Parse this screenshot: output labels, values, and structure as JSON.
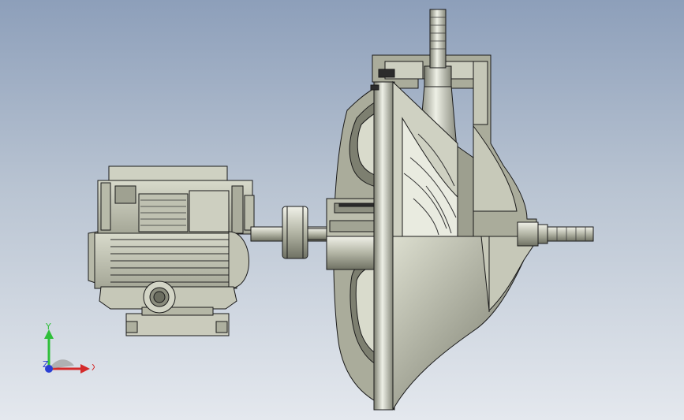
{
  "viewport": {
    "background_top": "#8d9fba",
    "background_bottom": "#e4e8ee"
  },
  "model": {
    "name": "pump-motor-section-view",
    "face_color": "#c9cbbb",
    "face_light": "#e6e8dc",
    "face_dark": "#8e907f",
    "edge_color": "#1a1a1a",
    "section_color": "#aeb09f"
  },
  "triad": {
    "x_label": "X",
    "y_label": "Y",
    "z_label": "Z",
    "x_color": "#d42a2a",
    "y_color": "#2fbf3a",
    "z_color": "#2a3fd4"
  }
}
